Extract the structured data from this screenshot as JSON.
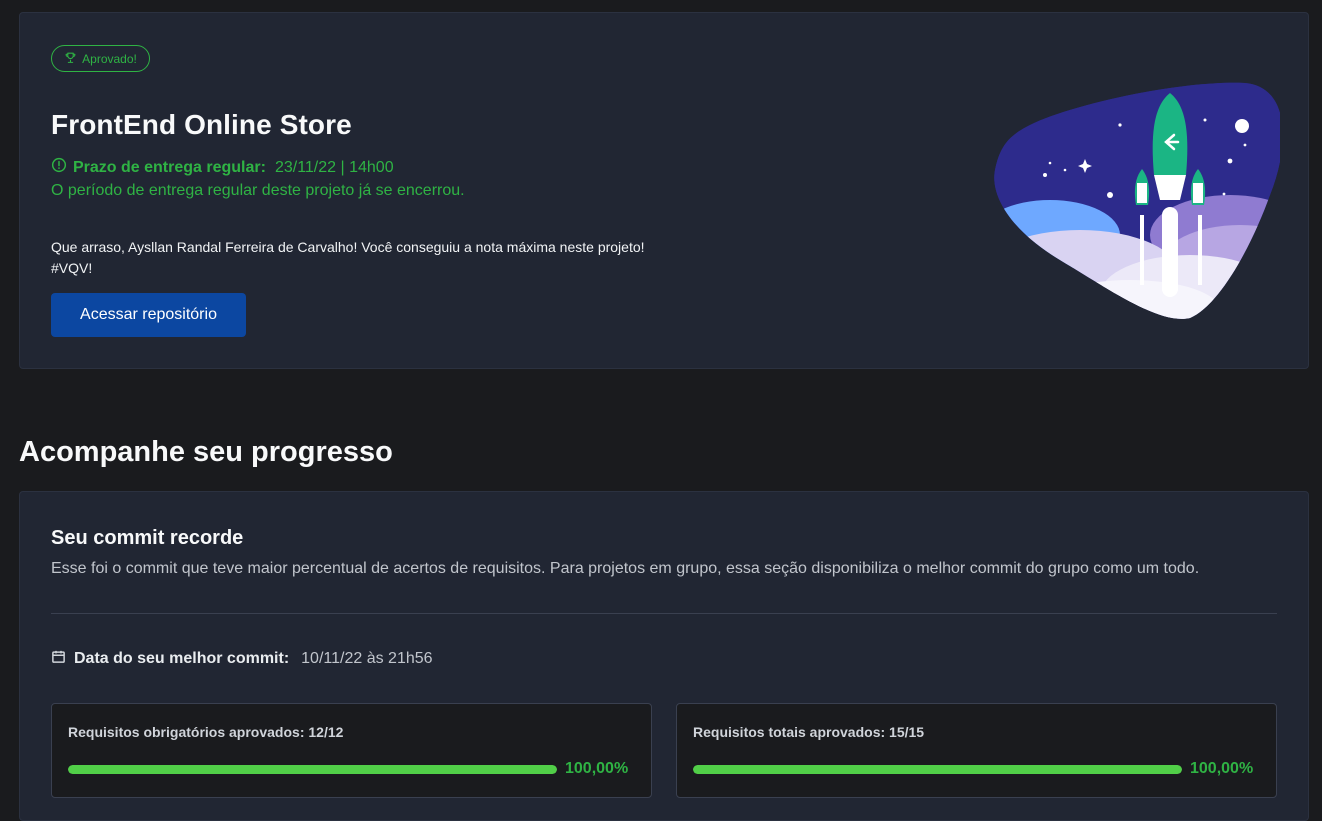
{
  "project": {
    "badge": "Aprovado!",
    "title": "FrontEnd Online Store",
    "deadline_label": "Prazo de entrega regular:",
    "deadline_value": "23/11/22 | 14h00",
    "deadline_note": "O período de entrega regular deste projeto já se encerrou.",
    "congrats_line1": "Que arraso, Aysllan Randal Ferreira de Carvalho! Você conseguiu a nota máxima neste projeto!",
    "congrats_line2": "#VQV!",
    "repo_button": "Acessar repositório"
  },
  "progress": {
    "section_title": "Acompanhe seu progresso",
    "card_title": "Seu commit recorde",
    "card_description": "Esse foi o commit que teve maior percentual de acertos de requisitos. Para projetos em grupo, essa seção disponibiliza o melhor commit do grupo como um todo.",
    "best_commit_label": "Data do seu melhor commit:",
    "best_commit_value": "10/11/22 às 21h56",
    "requirements": [
      {
        "label": "Requisitos obrigatórios aprovados: 12/12",
        "percent_text": "100,00%",
        "fraction": 1.0
      },
      {
        "label": "Requisitos totais aprovados: 15/15",
        "percent_text": "100,00%",
        "fraction": 1.0
      }
    ]
  },
  "colors": {
    "success": "#2fb344",
    "bar_fill": "#51cf48",
    "button": "#0c47a1",
    "card": "#212633",
    "background": "#1a1b1e"
  },
  "icons": [
    "trophy-icon",
    "alert-circle-icon",
    "calendar-icon",
    "rocket-illustration"
  ]
}
